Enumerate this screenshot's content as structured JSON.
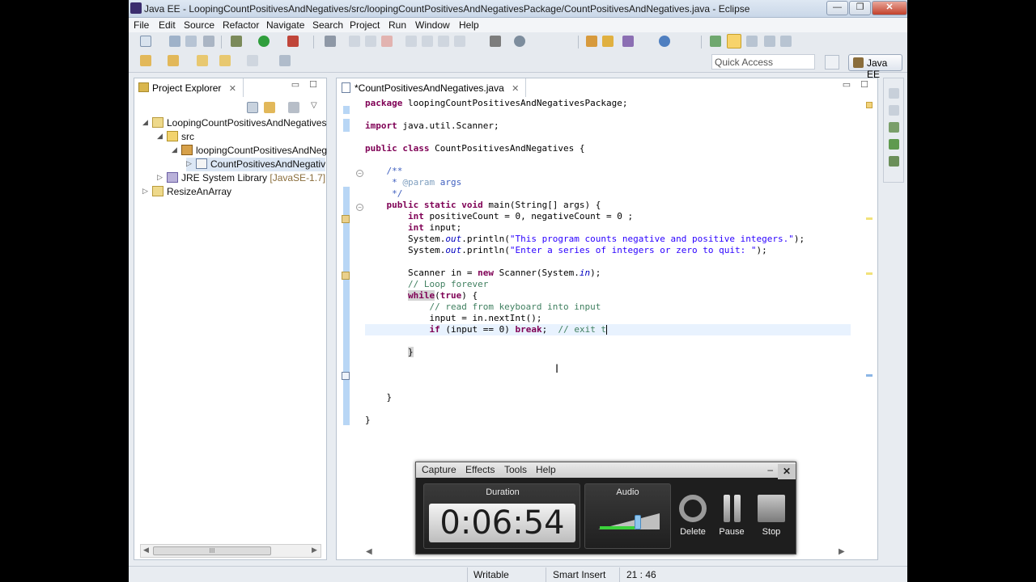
{
  "window": {
    "title": "Java EE - LoopingCountPositivesAndNegatives/src/loopingCountPositivesAndNegativesPackage/CountPositivesAndNegatives.java - Eclipse",
    "minimize": "—",
    "maximize": "❐",
    "close": "✕"
  },
  "menu": [
    "File",
    "Edit",
    "Source",
    "Refactor",
    "Navigate",
    "Search",
    "Project",
    "Run",
    "Window",
    "Help"
  ],
  "toolbar": {
    "quick_access_placeholder": "Quick Access",
    "perspective": "Java EE"
  },
  "explorer": {
    "title": "Project Explorer",
    "close": "✕",
    "tree": [
      {
        "label": "LoopingCountPositivesAndNegatives",
        "twisty": "◢",
        "icon": "project"
      },
      {
        "label": "src",
        "twisty": "◢",
        "icon": "folder"
      },
      {
        "label": "loopingCountPositivesAndNeg",
        "twisty": "◢",
        "icon": "package"
      },
      {
        "label": "CountPositivesAndNegativ",
        "twisty": "▷",
        "icon": "java"
      },
      {
        "label": "JRE System Library",
        "decor": "[JavaSE-1.7]",
        "twisty": "▷",
        "icon": "library"
      },
      {
        "label": "ResizeAnArray",
        "twisty": "▷",
        "icon": "project"
      }
    ],
    "scroll_thumb": "III"
  },
  "editor": {
    "tab_label": "*CountPositivesAndNegatives.java",
    "tab_close": "✕",
    "code": [
      "package loopingCountPositivesAndNegativesPackage;",
      "",
      "import java.util.Scanner;",
      "",
      "public class CountPositivesAndNegatives {",
      "",
      "    /**",
      "     * @param args",
      "     */",
      "    public static void main(String[] args) {",
      "        int positiveCount = 0, negativeCount = 0 ;",
      "        int input;",
      "        System.out.println(\"This program counts negative and positive integers.\");",
      "        System.out.println(\"Enter a series of integers or zero to quit: \");",
      "",
      "        Scanner in = new Scanner(System.in);",
      "        // Loop forever",
      "        while(true) {",
      "            // read from keyboard into input",
      "            input = in.nextInt();",
      "            if (input == 0) break;  // exit t",
      "",
      "        }",
      "",
      "",
      "",
      "    }",
      "",
      "}"
    ]
  },
  "status": {
    "writable": "Writable",
    "insert_mode": "Smart Insert",
    "position": "21 : 46"
  },
  "capture": {
    "menu": [
      "Capture",
      "Effects",
      "Tools",
      "Help"
    ],
    "minimize": "–",
    "close": "✕",
    "duration_label": "Duration",
    "duration": "0:06:54",
    "audio_label": "Audio",
    "audio_level": 0.66,
    "delete_label": "Delete",
    "pause_label": "Pause",
    "stop_label": "Stop"
  },
  "colors": {
    "keyword": "#7f0055",
    "string": "#2a00ff",
    "comment": "#3f7f5f",
    "javadoc": "#3f5fbf",
    "field": "#0000c0",
    "current_line": "#e8f2fe"
  }
}
